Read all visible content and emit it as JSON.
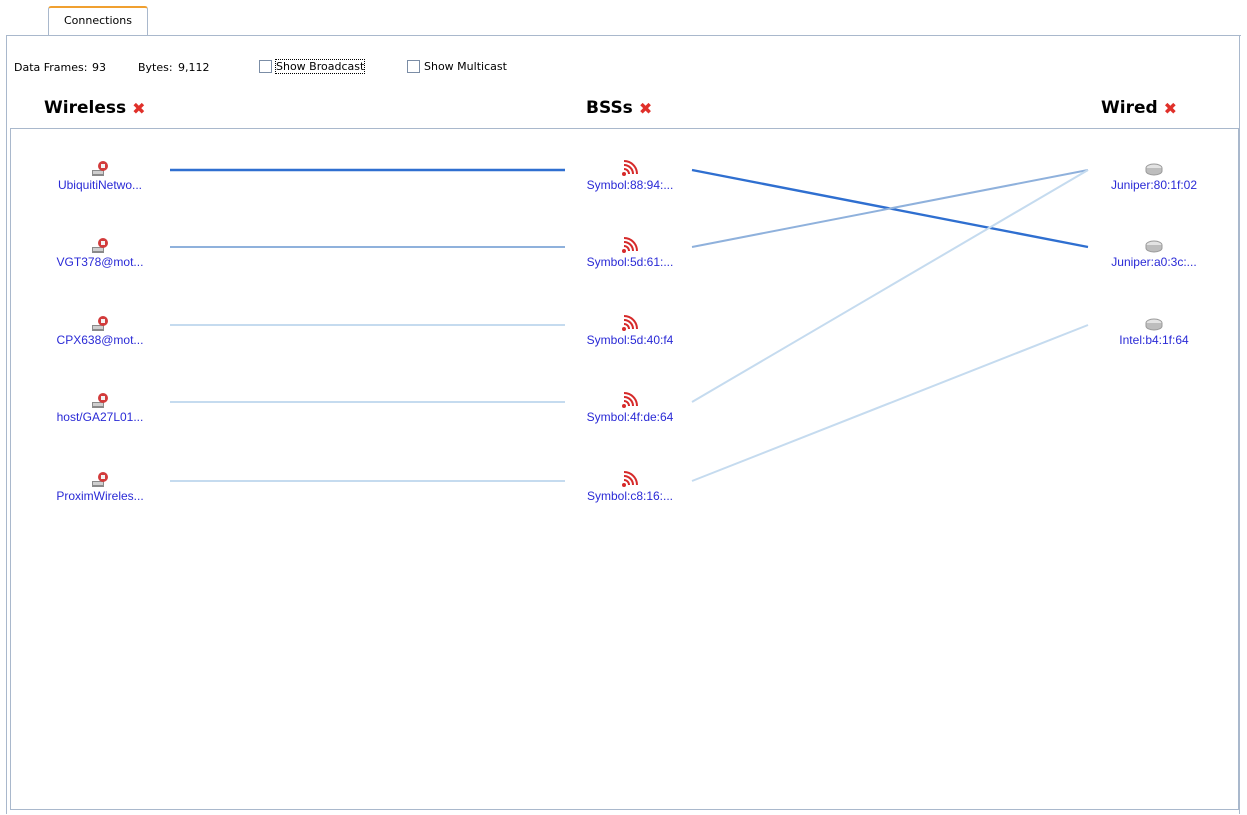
{
  "tab": {
    "label": "Connections"
  },
  "stats": {
    "frames_label": "Data Frames:",
    "frames_value": "93",
    "bytes_label": "Bytes:",
    "bytes_value": "9,112"
  },
  "options": {
    "broadcast": {
      "label": "Show Broadcast",
      "checked": false
    },
    "multicast": {
      "label": "Show Multicast",
      "checked": false
    }
  },
  "columns": {
    "wireless": {
      "title": "Wireless"
    },
    "bss": {
      "title": "BSSs"
    },
    "wired": {
      "title": "Wired"
    }
  },
  "wireless": [
    {
      "name": "UbiquitiNetwo...",
      "icon": "laptop-icon"
    },
    {
      "name": "VGT378@mot...",
      "icon": "laptop-icon"
    },
    {
      "name": "CPX638@mot...",
      "icon": "laptop-icon"
    },
    {
      "name": "host/GA27L01...",
      "icon": "laptop-icon"
    },
    {
      "name": "ProximWireles...",
      "icon": "laptop-icon"
    }
  ],
  "bss": [
    {
      "name": "Symbol:88:94:...",
      "icon": "wireless-signal-icon"
    },
    {
      "name": "Symbol:5d:61:...",
      "icon": "wireless-signal-icon"
    },
    {
      "name": "Symbol:5d:40:f4",
      "icon": "wireless-signal-icon"
    },
    {
      "name": "Symbol:4f:de:64",
      "icon": "wireless-signal-icon"
    },
    {
      "name": "Symbol:c8:16:...",
      "icon": "wireless-signal-icon"
    }
  ],
  "wired": [
    {
      "name": "Juniper:80:1f:02",
      "icon": "router-icon"
    },
    {
      "name": "Juniper:a0:3c:...",
      "icon": "router-icon"
    },
    {
      "name": "Intel:b4:1f:64",
      "icon": "router-icon"
    }
  ],
  "colors": {
    "close_x": "#e0302a",
    "link_text": "#2a2ad6",
    "wire_strong": "#2f6fd0",
    "wire_light": "#c5dbef",
    "signal": "#d62a2a"
  },
  "links": [
    {
      "from": "wireless.0",
      "to": "bss.0",
      "strength": "strong"
    },
    {
      "from": "wireless.1",
      "to": "bss.1",
      "strength": "medium"
    },
    {
      "from": "wireless.2",
      "to": "bss.2",
      "strength": "light"
    },
    {
      "from": "wireless.3",
      "to": "bss.3",
      "strength": "light"
    },
    {
      "from": "wireless.4",
      "to": "bss.4",
      "strength": "light"
    },
    {
      "from": "bss.0",
      "to": "wired.1",
      "strength": "strong"
    },
    {
      "from": "bss.1",
      "to": "wired.0",
      "strength": "medium"
    },
    {
      "from": "bss.3",
      "to": "wired.0",
      "strength": "light"
    },
    {
      "from": "bss.4",
      "to": "wired.2",
      "strength": "light"
    }
  ]
}
